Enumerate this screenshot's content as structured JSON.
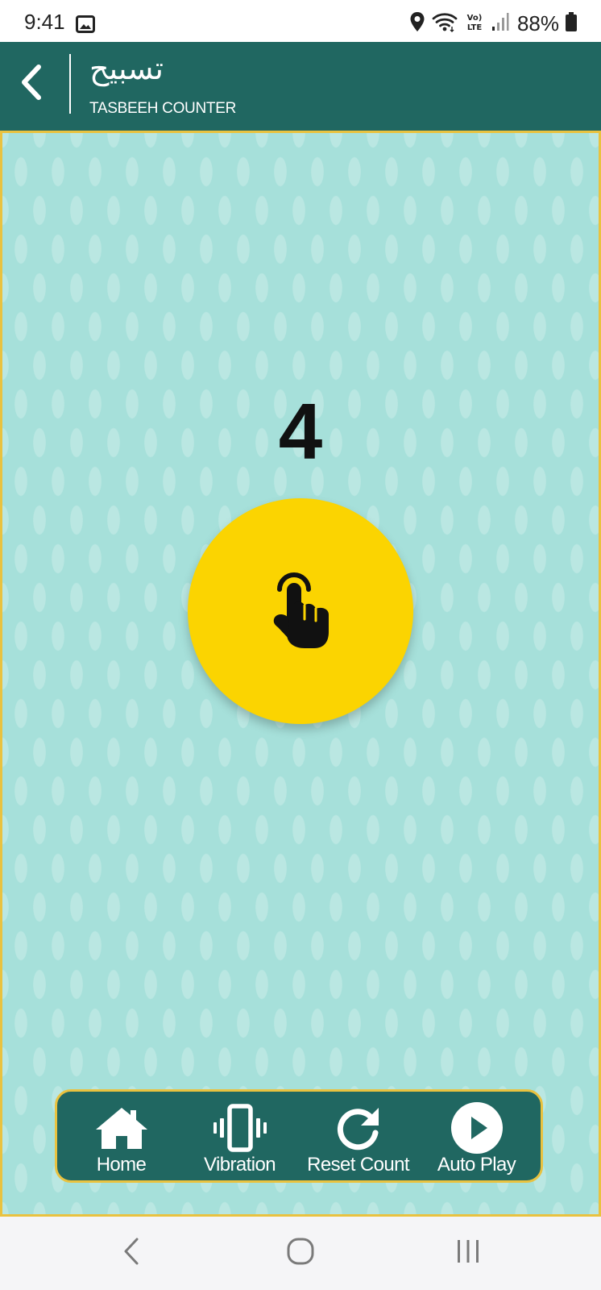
{
  "status_bar": {
    "time": "9:41",
    "battery": "88%",
    "icons": [
      "gallery-icon",
      "location-icon",
      "wifi-icon",
      "volte-icon",
      "signal-icon",
      "battery-icon"
    ]
  },
  "header": {
    "title_arabic": "تسبيح",
    "subtitle": "TASBEEH COUNTER",
    "back_icon": "chevron-left-icon"
  },
  "counter": {
    "value": "4",
    "tap_icon": "tap-hand-icon"
  },
  "toolbar": {
    "items": [
      {
        "label": "Home",
        "icon": "home-icon"
      },
      {
        "label": "Vibration",
        "icon": "vibration-icon"
      },
      {
        "label": "Reset Count",
        "icon": "refresh-icon"
      },
      {
        "label": "Auto Play",
        "icon": "play-circle-icon"
      }
    ]
  },
  "system_nav": {
    "icons": [
      "nav-back-icon",
      "nav-home-icon",
      "nav-recents-icon"
    ]
  },
  "colors": {
    "header_bg": "#206761",
    "background": "#a6e0da",
    "accent_gold": "#e9c23f",
    "tap_button": "#fbd401",
    "text_dark": "#111111"
  }
}
